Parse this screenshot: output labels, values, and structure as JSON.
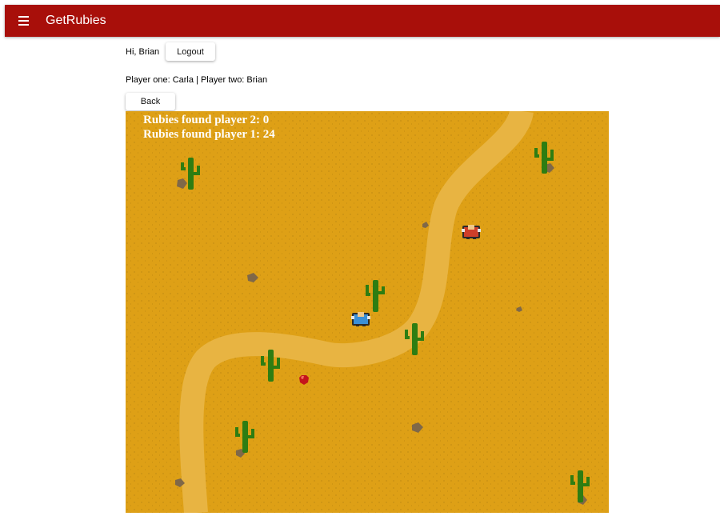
{
  "app": {
    "title": "GetRubies",
    "menu_icon": "hamburger-menu-icon",
    "bar_color": "#a80f0a"
  },
  "user": {
    "greeting": "Hi, Brian",
    "logout_label": "Logout"
  },
  "match": {
    "players_text": "Player one: Carla | Player two: Brian",
    "back_label": "Back"
  },
  "game": {
    "score_player2_label": "Rubies found player 2:",
    "score_player2_value": "0",
    "score_player1_label": "Rubies found player 1:",
    "score_player1_value": "24",
    "sand_color": "#dea016",
    "path_color": "#e8b442",
    "cactus_color": "#2e7d12",
    "ruby_color": "#c4141c",
    "player_blue": "#3b8fd6",
    "player_red": "#cf3f2a"
  }
}
